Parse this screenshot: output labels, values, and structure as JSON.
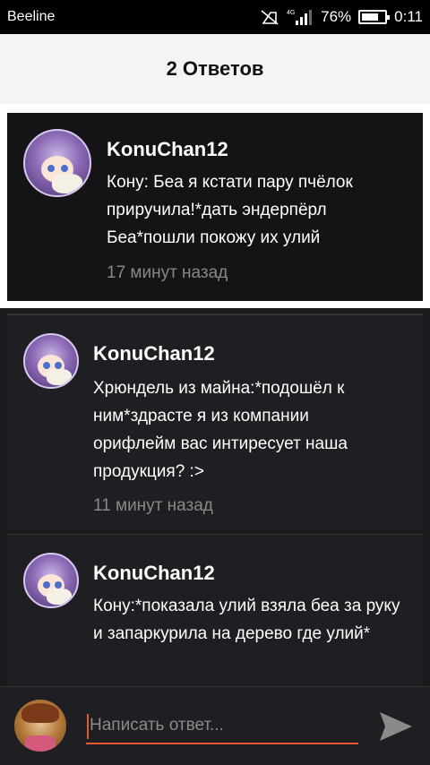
{
  "statusbar": {
    "carrier": "Beeline",
    "network": "4G",
    "battery": "76%",
    "time": "0:11",
    "battery_level": 0.76
  },
  "header": {
    "title": "2 Ответов"
  },
  "parent_comment": {
    "author": "KonuChan12",
    "text": "Кону: Беа я кстати пару пчёлок приручила!*дать эндерпёрл Беа*пошли покожу их улий",
    "time": "17 минут назад"
  },
  "replies": [
    {
      "author": "KonuChan12",
      "text": "Хрюндель из майна:*подошёл к ним*здрасте я из компании орифлейм вас интиресует наша продукция? :>",
      "time": "11 минут назад"
    },
    {
      "author": "KonuChan12",
      "text": "Кону:*показала улий взяла беа за руку и запаркурила на дерево где улий*",
      "time": ""
    }
  ],
  "composer": {
    "placeholder": "Написать ответ..."
  },
  "colors": {
    "accent": "#e6582f",
    "background": "#1a1a1c",
    "card": "#141416"
  }
}
